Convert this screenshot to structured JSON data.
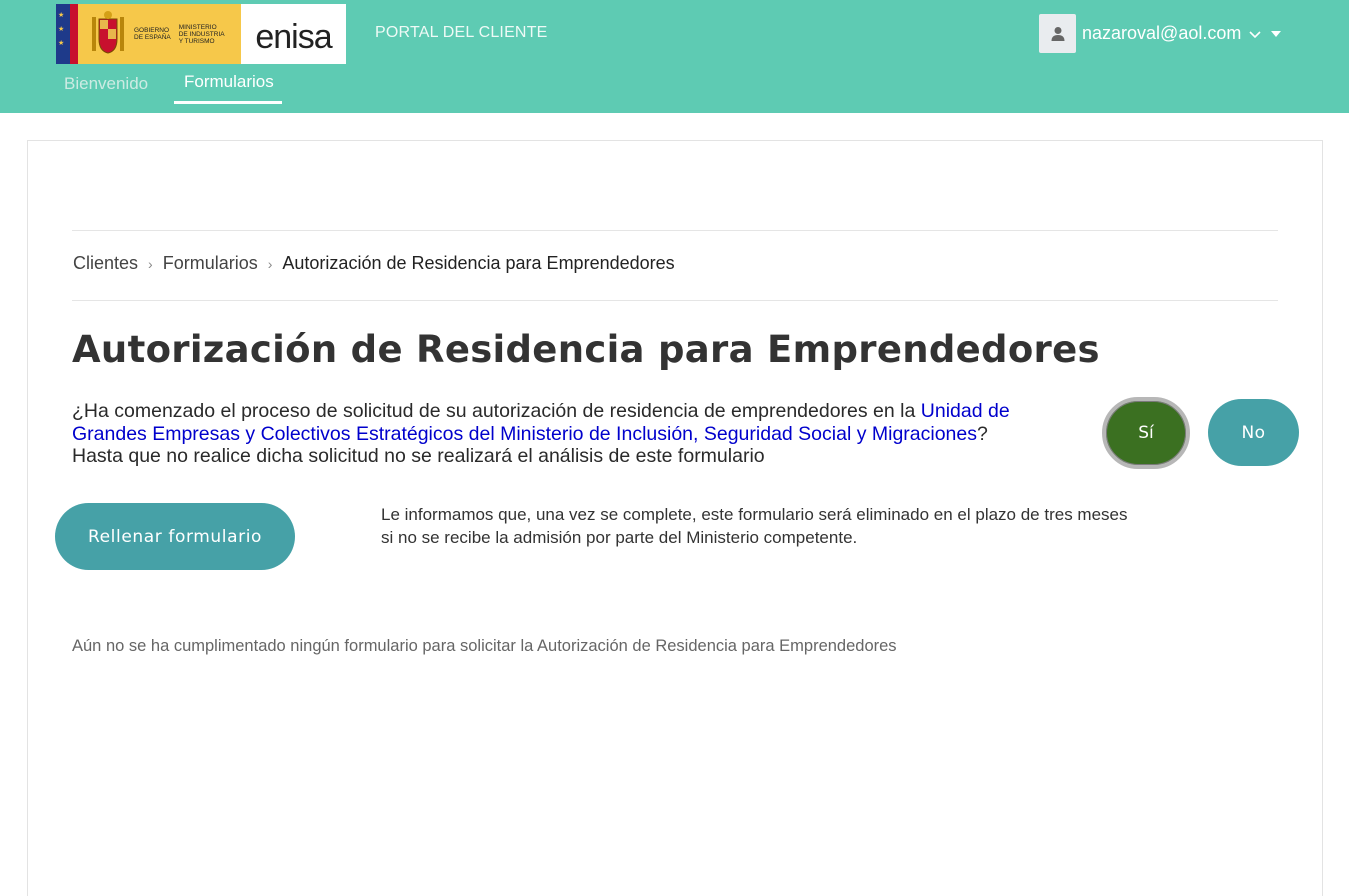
{
  "header": {
    "logo": {
      "gov_line1": "GOBIERNO",
      "gov_line2": "DE ESPAÑA",
      "min_line1": "MINISTERIO",
      "min_line2": "DE INDUSTRIA",
      "min_line3": "Y TURISMO",
      "brand": "enisa"
    },
    "portal_label": "PORTAL DEL CLIENTE",
    "user": {
      "email": "nazaroval@aol.com",
      "avatar_icon": "user-icon"
    },
    "tabs": [
      {
        "label": "Bienvenido",
        "active": false
      },
      {
        "label": "Formularios",
        "active": true
      }
    ]
  },
  "breadcrumb": {
    "items": [
      "Clientes",
      "Formularios",
      "Autorización de Residencia para Emprendedores"
    ]
  },
  "main": {
    "title": "Autorización de Residencia para Emprendedores",
    "question_pre": "¿Ha comenzado el proceso de solicitud de su autorización de residencia de emprendedores en la ",
    "question_link": "Unidad de Grandes Empresas y Colectivos Estratégicos del Ministerio de Inclusión, Seguridad Social y Migraciones",
    "question_post": "?",
    "question_note": "Hasta que no realice dicha solicitud no se realizará el análisis de este formulario",
    "yes_label": "Sí",
    "no_label": "No",
    "fill_label": "Rellenar formulario",
    "info_text": "Le informamos que, una vez se complete, este formulario será eliminado en el plazo de tres meses si no se recibe la admisión por parte del Ministerio competente.",
    "empty_message": "Aún no se ha cumplimentado ningún formulario para solicitar la Autorización de Residencia para Emprendedores"
  },
  "colors": {
    "header_bg": "#5ecbb3",
    "button_teal": "#46a1a7",
    "button_selected": "#3b7021",
    "link": "#0000cc"
  }
}
